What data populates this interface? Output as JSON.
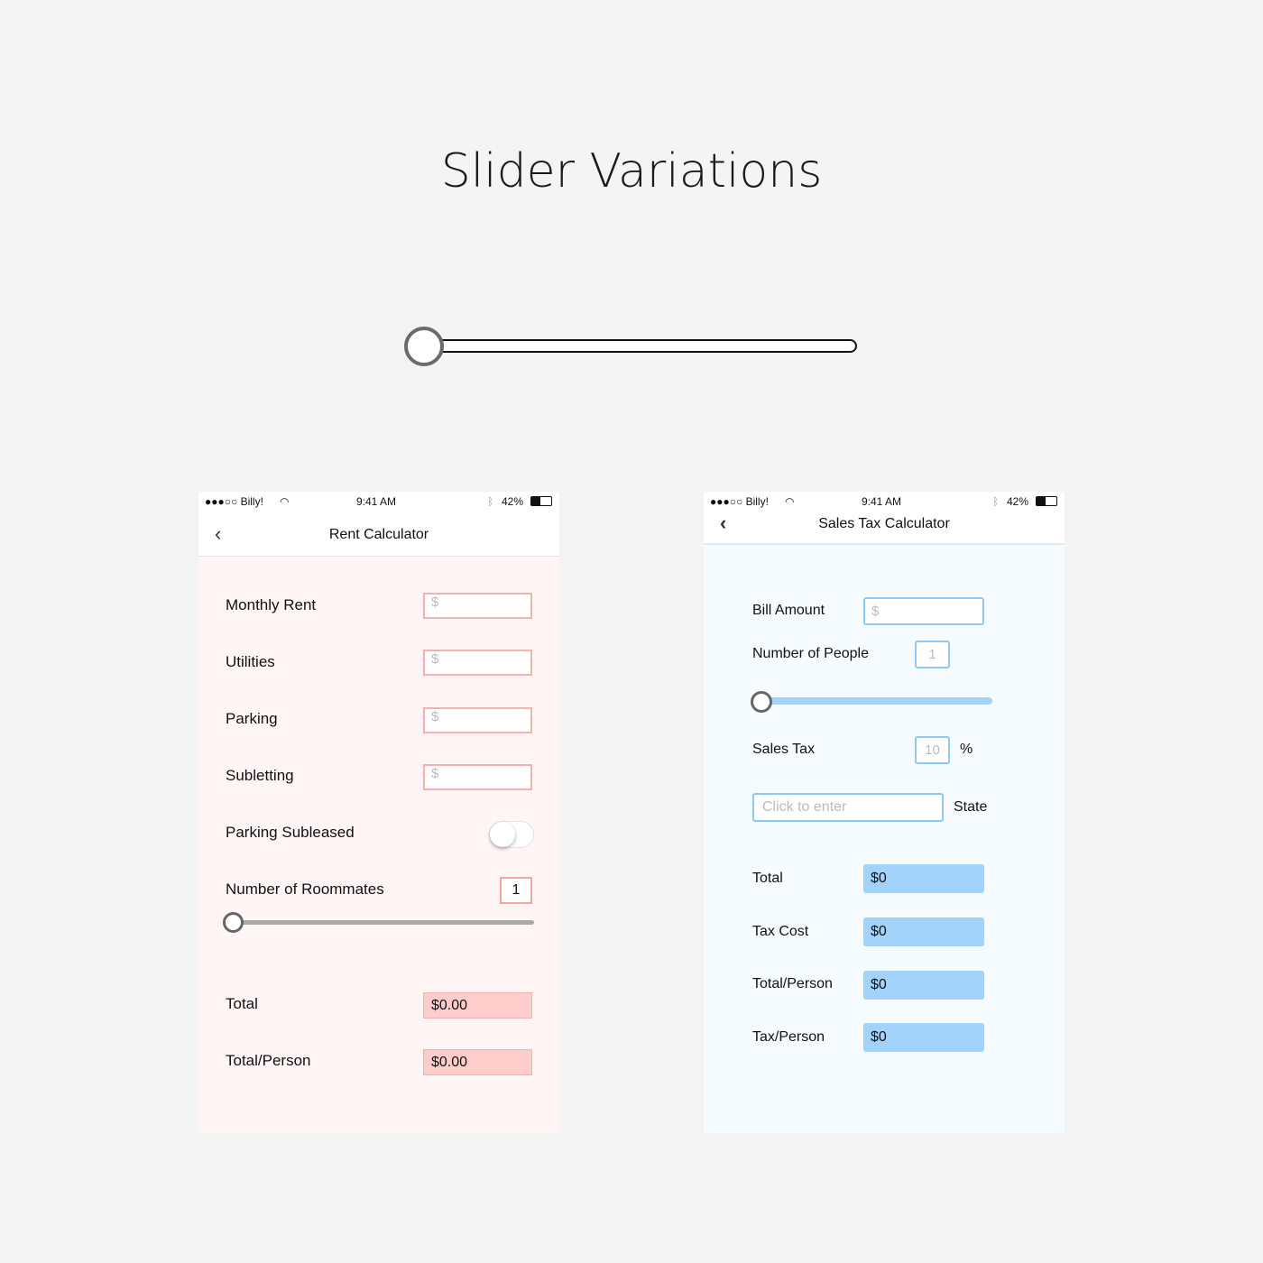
{
  "title": "Slider Variations",
  "status": {
    "carrier": "●●●○○ Billy!",
    "time": "9:41 AM",
    "battery": "42%"
  },
  "rent": {
    "title": "Rent Calculator",
    "fields": [
      {
        "label": "Monthly Rent",
        "placeholder": "$"
      },
      {
        "label": "Utilities",
        "placeholder": "$"
      },
      {
        "label": "Parking",
        "placeholder": "$"
      },
      {
        "label": "Subletting",
        "placeholder": "$"
      }
    ],
    "toggle_label": "Parking Subleased",
    "roommates_label": "Number of Roommates",
    "roommates_value": "1",
    "total_label": "Total",
    "total_value": "$0.00",
    "per_label": "Total/Person",
    "per_value": "$0.00"
  },
  "sales": {
    "title": "Sales Tax Calculator",
    "bill_label": "Bill Amount",
    "bill_placeholder": "$",
    "people_label": "Number of People",
    "people_value": "1",
    "tax_label": "Sales Tax",
    "tax_value": "10",
    "percent": "%",
    "state_placeholder": "Click to enter",
    "state_label": "State",
    "outputs": [
      {
        "label": "Total",
        "value": "$0"
      },
      {
        "label": "Tax Cost",
        "value": "$0"
      },
      {
        "label": "Total/Person",
        "value": "$0"
      },
      {
        "label": "Tax/Person",
        "value": "$0"
      }
    ]
  },
  "colors": {
    "rent_accent": "#f5a3a3",
    "sales_accent": "#9fd0fb"
  }
}
